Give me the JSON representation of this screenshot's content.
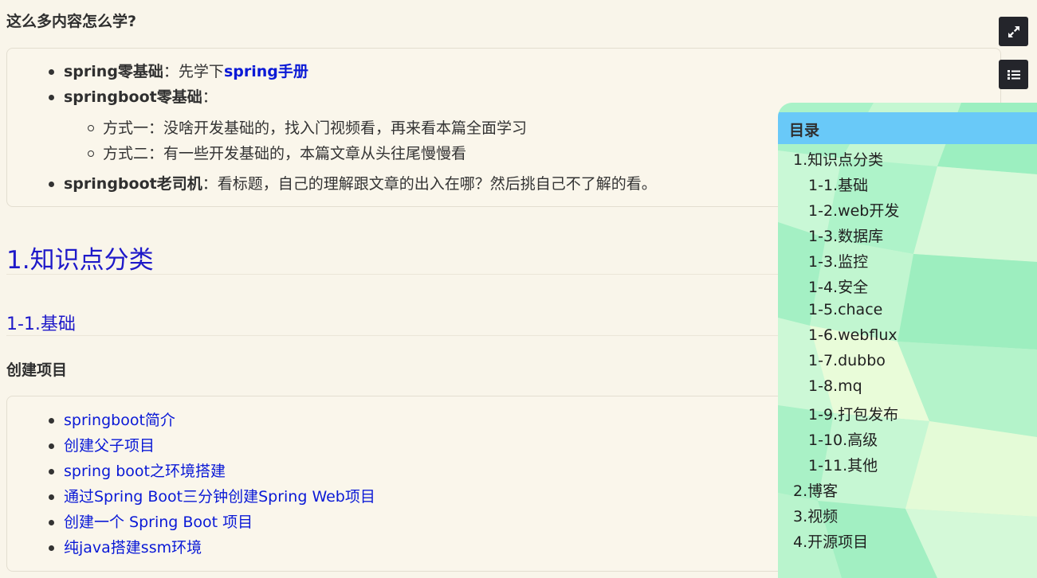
{
  "intro": {
    "heading": "这么多内容怎么学?",
    "items": [
      {
        "bold": "spring零基础",
        "sep": "：先学下",
        "link": "spring手册"
      },
      {
        "bold": "springboot零基础",
        "sep": "："
      },
      {
        "bold": "springboot老司机",
        "text": "：看标题，自己的理解跟文章的出入在哪？然后挑自己不了解的看。"
      }
    ],
    "subitems": [
      "方式一：没啥开发基础的，找入门视频看，再来看本篇全面学习",
      "方式二：有一些开发基础的，本篇文章从头往尾慢慢看"
    ]
  },
  "section1": {
    "title": "1.知识点分类",
    "sub_title": "1-1.基础",
    "group_title": "创建项目",
    "links": [
      "springboot简介",
      "创建父子项目",
      "spring boot之环境搭建",
      "通过Spring Boot三分钟创建Spring Web项目",
      "创建一个 Spring Boot 项目",
      "纯java搭建ssm环境"
    ]
  },
  "toolbar": {
    "expand_icon": "expand-icon",
    "toc_icon": "list-icon"
  },
  "toc": {
    "title": "目录",
    "items": [
      {
        "label": "1.知识点分类",
        "level": 1
      },
      {
        "label": "1-1.基础",
        "level": 2
      },
      {
        "label": "1-2.web开发",
        "level": 2
      },
      {
        "label": "1-3.数据库",
        "level": 2
      },
      {
        "label": "1-3.监控",
        "level": 2
      },
      {
        "label": "1-4.安全",
        "level": 2
      },
      {
        "label": "1-5.chace",
        "level": 2
      },
      {
        "label": "1-6.webflux",
        "level": 2
      },
      {
        "label": "1-7.dubbo",
        "level": 2
      },
      {
        "label": "1-8.mq",
        "level": 2
      },
      {
        "label": "1-9.打包发布",
        "level": 2
      },
      {
        "label": "1-10.高级",
        "level": 2
      },
      {
        "label": "1-11.其他",
        "level": 2
      },
      {
        "label": "2.博客",
        "level": 1
      },
      {
        "label": "3.视频",
        "level": 1
      },
      {
        "label": "4.开源项目",
        "level": 1
      }
    ]
  },
  "colors": {
    "link": "#0a19d6",
    "heading": "#1e19c9",
    "background": "#f9f5ea",
    "toc_header": "#69c9f8",
    "toc_bg": "#bff5cf",
    "button": "#24252b"
  }
}
